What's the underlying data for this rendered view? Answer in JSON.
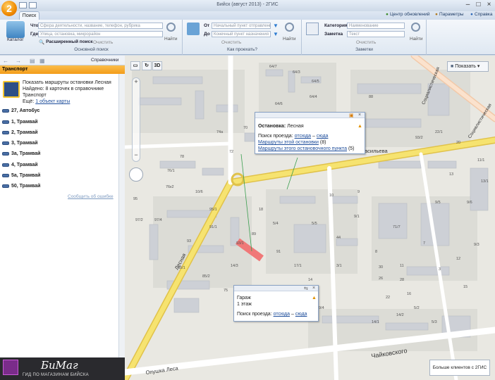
{
  "window": {
    "title": "Бийск (август 2013) - 2ГИС"
  },
  "tabs": [
    {
      "label": "Поиск"
    }
  ],
  "toplinks": {
    "updates": "Центр обновлений",
    "params": "Параметры",
    "help": "Справка"
  },
  "ribbon": {
    "catalog_label": "Каталог",
    "what_label": "Что",
    "what_placeholder": "Сфера деятельности, название, телефон, рубрика",
    "where_label": "Где",
    "where_placeholder": "Улица, остановка, микрорайон",
    "advanced_search": "Расширенный поиск",
    "clear": "Очистить",
    "find": "Найти",
    "group_basic": "Основной поиск",
    "from_label": "От",
    "from_placeholder": "Начальный пункт отправления",
    "to_label": "До",
    "to_placeholder": "Конечный пункт назначения",
    "route_clear": "Очистить",
    "route_find": "Найти",
    "group_route": "Как проехать?",
    "category_label": "Категория",
    "category_value": "Наименование",
    "note_label": "Заметка",
    "note_placeholder": "Текст",
    "note_clear": "Очистить",
    "note_find": "Найти",
    "group_notes": "Заметки"
  },
  "left_panel": {
    "toolbar_dropdown": "Справочники",
    "header": "Транспорт",
    "info_title": "Показать маршруты остановки Лесная",
    "info_found": "Найдено: 8 карточек в справочнике Транспорт",
    "info_more_prefix": "Ещё:",
    "info_more_link": "1 объект карты",
    "routes": [
      "27, Автобус",
      "1, Трамвай",
      "2, Трамвай",
      "3, Трамвай",
      "3а, Трамвай",
      "4, Трамвай",
      "5а, Трамвай",
      "50, Трамвай"
    ],
    "report_error": "Сообщить об ошибке",
    "ad_brand": "БиМаг",
    "ad_sub": "ГИД ПО МАГАЗИНАМ БИЙСКА"
  },
  "map": {
    "show_button": "Показать",
    "mode_3d": "3D",
    "more_clients": "Больше клиентов с 2ГИС",
    "streets": {
      "vasilyeva": "Васильева",
      "lesnaya": "Лесная",
      "chaikovskogo": "Чайковского",
      "opushka": "Опушка Леса",
      "sotsialisticheskaya1": "Социалистическая",
      "sotsialisticheskaya2": "Социалистическая"
    },
    "house_numbers": [
      "64/7",
      "64/3",
      "64/5",
      "64/4",
      "64/6",
      "70",
      "72",
      "74а",
      "76/1",
      "76к2",
      "78",
      "76",
      "80",
      "82",
      "84",
      "86",
      "88",
      "95",
      "97/2",
      "97/4",
      "93",
      "91/1",
      "93/1",
      "85/1",
      "85/2",
      "75",
      "11/1",
      "13",
      "13/1",
      "9/6",
      "9/5",
      "10",
      "9",
      "9/1",
      "8",
      "30",
      "26",
      "28",
      "22",
      "14/1",
      "14/2",
      "11",
      "16",
      "5/2",
      "5/3",
      "5/4",
      "5/5",
      "44",
      "89",
      "91",
      "17/1",
      "14",
      "14/3",
      "50",
      "95/1",
      "10/6",
      "18",
      "22/1",
      "20",
      "93/2",
      "71/7",
      "7",
      "3",
      "12",
      "15",
      "9/3",
      "3/1",
      "9/4"
    ],
    "popup_stop": {
      "label": "Остановка:",
      "name": "Лесная",
      "route_prefix": "Поиск проезда:",
      "from_here": "отсюда",
      "dash": "–",
      "to_here": "сюда",
      "link1": "Маршруты этой остановки",
      "link1_count": "(8)",
      "link2": "Маршруты этого остановочного пункта",
      "link2_count": "(5)"
    },
    "popup_garage": {
      "title": "Гараж",
      "floors": "1 этаж",
      "route_prefix": "Поиск проезда:",
      "from_here": "отсюда",
      "dash": "–",
      "to_here": "сюда"
    }
  },
  "colors": {
    "accent": "#f39c1a",
    "road_main": "#f6e370",
    "road_edge": "#e0c24a",
    "building": "#cdd0d6",
    "link": "#1d4d9b",
    "highlight": "#f07070"
  }
}
